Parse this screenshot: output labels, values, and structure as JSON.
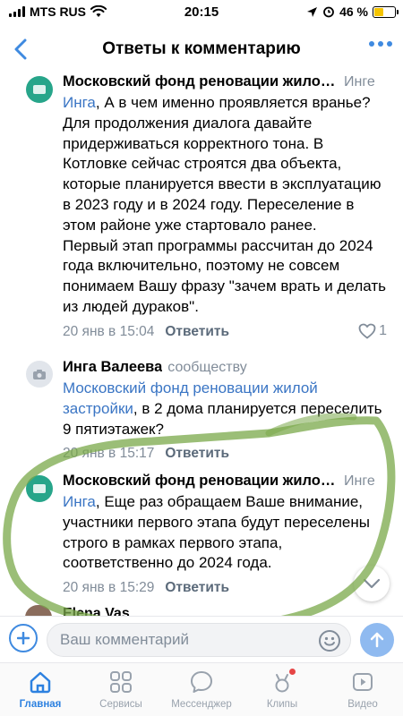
{
  "status_bar": {
    "carrier": "MTS RUS",
    "time": "20:15",
    "battery_percent": "46 %",
    "battery_level": 0.46
  },
  "header": {
    "title": "Ответы к комментарию"
  },
  "comments": [
    {
      "author": "Московский фонд реновации жилой застройки",
      "reply_to": "Инге",
      "mention": "Инга",
      "text": ", А в чем именно проявляется вранье? Для продолжения диалога давайте придерживаться корректного тона. В Котловке сейчас строятся два объекта, которые планируется ввести в эксплуатацию в 2023 году и в 2024 году. Переселение в этом районе уже стартовало ранее.",
      "text2": "Первый этап программы рассчитан до 2024 года включительно, поэтому не совсем понимаем Вашу фразу \"зачем врать и делать из людей дураков\".",
      "date": "20 янв в 15:04",
      "reply_label": "Ответить",
      "likes": "1"
    },
    {
      "author": "Инга Валеева",
      "reply_to": "сообществу",
      "mention": "Московский фонд реновации жилой застройки",
      "text": ", в 2 дома планируется переселить 9 пятиэтажек?",
      "date": "20 янв в 15:17",
      "reply_label": "Ответить"
    },
    {
      "author": "Московский фонд реновации жилой застройки",
      "reply_to": "Инге",
      "mention": "Инга",
      "text": ", Еще раз обращаем Ваше внимание, участники первого этапа будут переселены строго в рамках первого этапа, соответственно до 2024 года.",
      "date": "20 янв в 15:29",
      "reply_label": "Ответить"
    },
    {
      "author": "Elena Vas"
    }
  ],
  "composer": {
    "placeholder": "Ваш комментарий"
  },
  "tabbar": [
    {
      "label": "Главная",
      "icon": "home-icon",
      "active": true
    },
    {
      "label": "Сервисы",
      "icon": "services-icon"
    },
    {
      "label": "Мессенджер",
      "icon": "messenger-icon"
    },
    {
      "label": "Клипы",
      "icon": "clips-icon",
      "badge": true
    },
    {
      "label": "Видео",
      "icon": "video-icon"
    }
  ],
  "colors": {
    "accent": "#3f8ae0",
    "link": "#3a75c4",
    "secondary_text": "#818c99",
    "highlight_marker": "#7aa84a"
  }
}
